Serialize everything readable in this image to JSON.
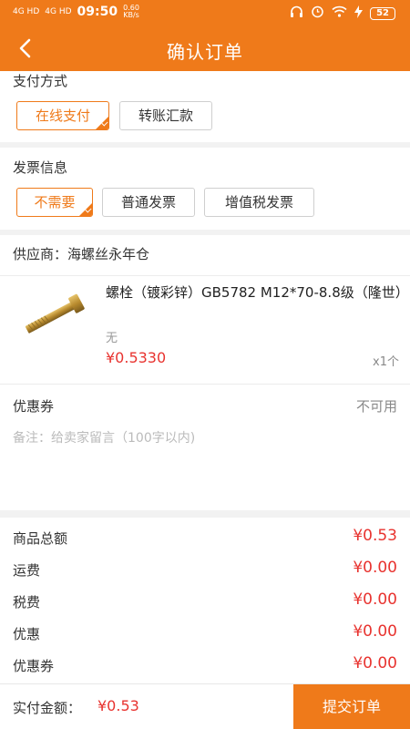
{
  "status_bar": {
    "signal_1": "4G HD",
    "signal_2": "4G HD",
    "time": "09:50",
    "speed_value": "0.60",
    "speed_unit": "KB/s",
    "icons": [
      "headphones-icon",
      "alarm-icon",
      "wifi-icon",
      "charging-icon"
    ],
    "battery": "52"
  },
  "header": {
    "title": "确认订单",
    "back_icon": "chevron-left-icon"
  },
  "payment": {
    "title": "支付方式",
    "options": [
      {
        "label": "在线支付",
        "selected": true
      },
      {
        "label": "转账汇款",
        "selected": false
      }
    ]
  },
  "invoice": {
    "title": "发票信息",
    "options": [
      {
        "label": "不需要",
        "selected": true
      },
      {
        "label": "普通发票",
        "selected": false
      },
      {
        "label": "增值税发票",
        "selected": false
      }
    ]
  },
  "supplier": {
    "text": "供应商：海螺丝永年仓"
  },
  "product": {
    "name": "螺栓（镀彩锌）GB5782 M12*70-8.8级（隆世）",
    "spec": "无",
    "price": "¥0.5330",
    "quantity": "x1个",
    "image_icon": "bolt-image"
  },
  "coupon": {
    "label": "优惠券",
    "value": "不可用"
  },
  "remark": {
    "placeholder": "备注：给卖家留言（100字以内)"
  },
  "summary": [
    {
      "label": "商品总额",
      "value": "¥0.53"
    },
    {
      "label": "运费",
      "value": "¥0.00"
    },
    {
      "label": "税费",
      "value": "¥0.00"
    },
    {
      "label": "优惠",
      "value": "¥0.00"
    },
    {
      "label": "优惠券",
      "value": "¥0.00"
    }
  ],
  "footer": {
    "paid_label": "实付金额：",
    "paid_value": "¥0.53",
    "submit_label": "提交订单"
  },
  "colors": {
    "accent": "#ef7a1a",
    "price": "#e8332f",
    "background": "#f2f2f2"
  }
}
